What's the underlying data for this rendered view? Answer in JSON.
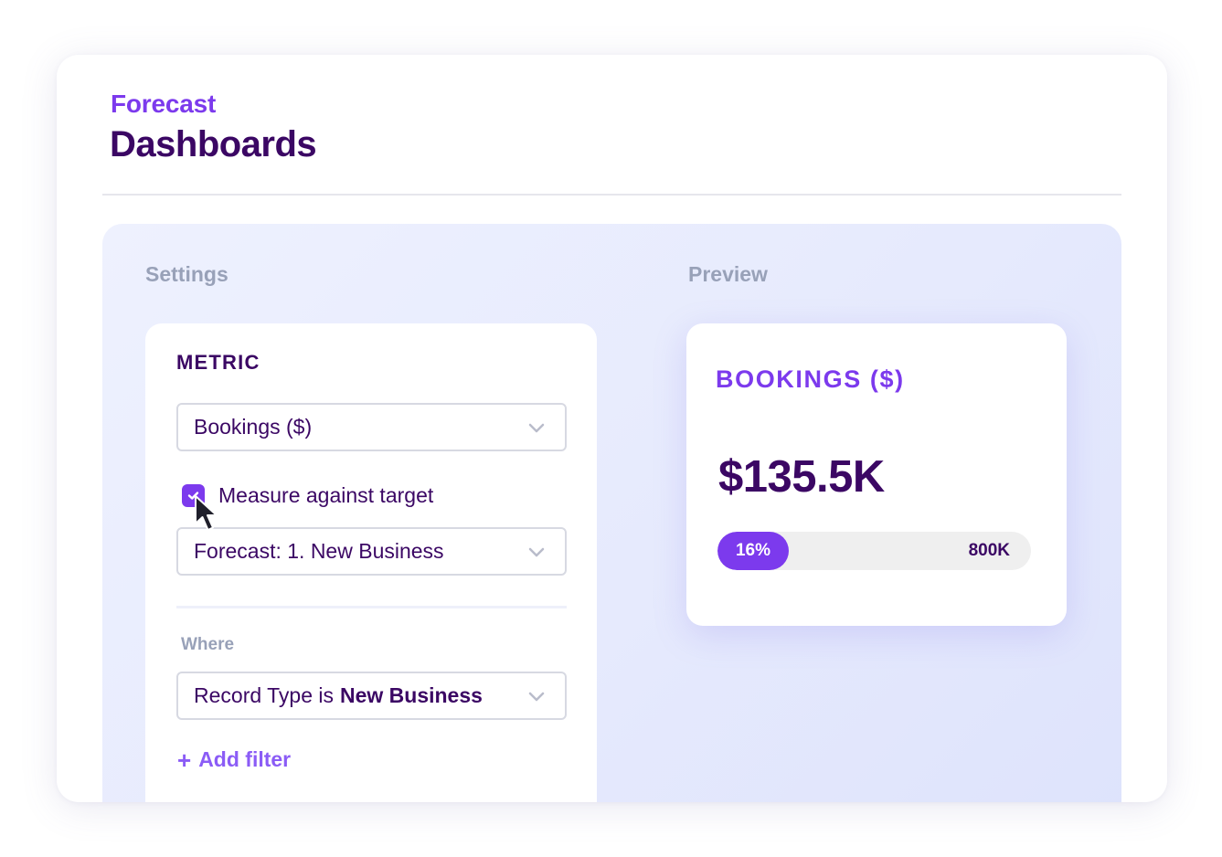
{
  "header": {
    "eyebrow": "Forecast",
    "title": "Dashboards"
  },
  "settings": {
    "section_label": "Settings",
    "metric_heading": "METRIC",
    "metric_select": {
      "value": "Bookings ($)",
      "icon": "chevron-down-icon"
    },
    "measure_checkbox": {
      "label": "Measure against target",
      "checked": true,
      "icon": "check-icon"
    },
    "target_select": {
      "value": "Forecast: 1. New Business",
      "icon": "chevron-down-icon"
    },
    "where_label": "Where",
    "filter_select": {
      "prefix": "Record Type is",
      "value": "New Business",
      "icon": "chevron-down-icon"
    },
    "add_filter": {
      "label": "Add filter",
      "icon": "plus-icon"
    }
  },
  "preview": {
    "section_label": "Preview",
    "card_title": "BOOKINGS ($)",
    "value": "$135.5K",
    "progress": {
      "percent_label": "16%",
      "percent": 16,
      "target_label": "800K"
    }
  },
  "colors": {
    "brand_purple": "#7c3aed",
    "dark_purple": "#3b0764",
    "muted_label": "#98a1b8"
  }
}
